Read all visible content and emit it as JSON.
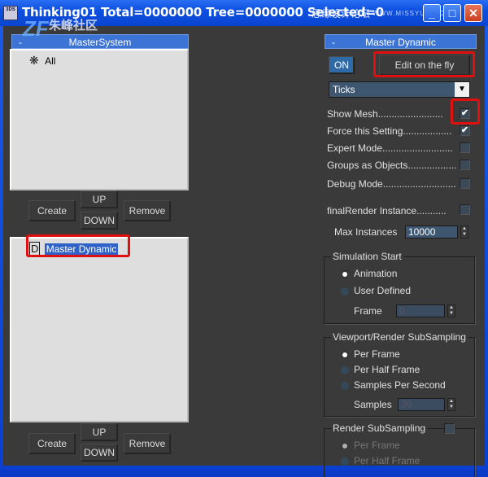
{
  "window": {
    "title": "Thinking01  Total=0000000  Tree=0000000  Selected=0",
    "app_icon_label": "3DS",
    "watermarks": [
      "朱峰社区",
      "ZF",
      "思缘设计论坛",
      "WWW.MISSYUAN.COM"
    ],
    "buttons": {
      "minimize": "_",
      "maximize": "□",
      "close": "✕"
    }
  },
  "left": {
    "system_rollout": {
      "label": "MasterSystem",
      "collapse_symbol": "-",
      "items": [
        {
          "icon": "particle-system-icon",
          "label": "All"
        }
      ]
    },
    "system_buttons": {
      "create": "Create",
      "up": "UP",
      "down": "DOWN",
      "remove": "Remove"
    },
    "dynamic_list": {
      "items": [
        {
          "icon": "master-dynamic-icon",
          "label": "Master Dynamic",
          "selected": true
        }
      ]
    },
    "dynamic_buttons": {
      "create": "Create",
      "up": "UP",
      "down": "DOWN",
      "remove": "Remove"
    }
  },
  "right": {
    "rollout": {
      "label": "Master Dynamic",
      "collapse_symbol": "-"
    },
    "on_button": "ON",
    "edit_button": "Edit on the fly",
    "mode_select": {
      "value": "Ticks"
    },
    "options": [
      {
        "label": "Show Mesh........................",
        "checked": true
      },
      {
        "label": "Force this Setting..................",
        "checked": true
      },
      {
        "label": "Expert Mode..........................",
        "checked": false
      },
      {
        "label": "Groups as Objects..................",
        "checked": false
      },
      {
        "label": "Debug Mode...........................",
        "checked": false
      }
    ],
    "final_render": {
      "label": "finalRender Instance...........",
      "checked": false
    },
    "max_instances": {
      "label": "Max Instances",
      "value": "10000"
    },
    "simulation_start": {
      "title": "Simulation Start",
      "options": [
        {
          "label": "Animation",
          "selected": true
        },
        {
          "label": "User Defined",
          "selected": false
        }
      ],
      "frame": {
        "label": "Frame",
        "value": "0"
      }
    },
    "viewport_subsampling": {
      "title": "Viewport/Render SubSampling",
      "options": [
        {
          "label": "Per Frame",
          "selected": true
        },
        {
          "label": "Per Half Frame",
          "selected": false
        },
        {
          "label": "Samples Per Second",
          "selected": false
        }
      ],
      "samples": {
        "label": "Samples",
        "value": "30"
      }
    },
    "render_subsampling": {
      "title": "Render SubSampling",
      "enabled": false,
      "options": [
        {
          "label": "Per Frame",
          "selected": true
        },
        {
          "label": "Per Half Frame",
          "selected": false
        }
      ]
    }
  },
  "colors": {
    "highlight_red": "#e01010",
    "rollout_blue": "#3c74d6",
    "panel_bg": "#3a3a3a"
  }
}
